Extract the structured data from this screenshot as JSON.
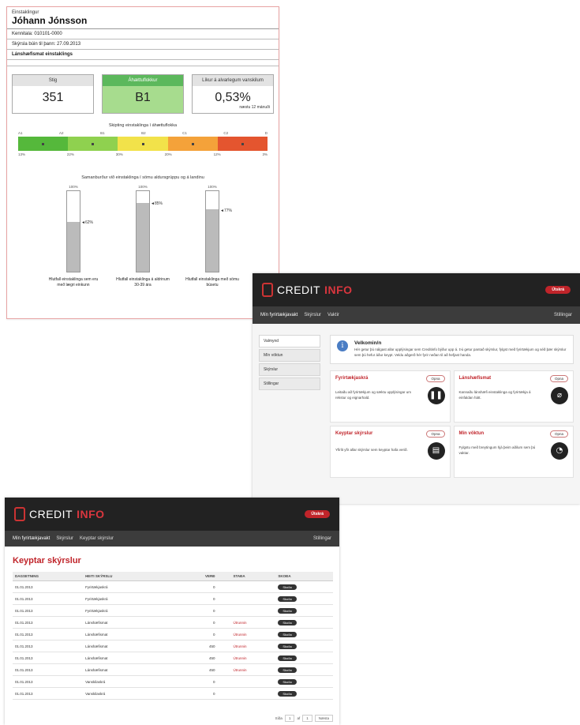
{
  "report": {
    "subject_label": "Einstaklingur",
    "subject_name": "Jóhann Jónsson",
    "line1": "Kennitala: 010101-0000",
    "line2": "Skýrsla búin til þann: 27.09.2013",
    "line3": "Lánshæfismat einstaklings",
    "boxes": [
      {
        "title": "Stig",
        "value": "351",
        "note": ""
      },
      {
        "title": "Áhættuflokkur",
        "value": "B1",
        "note": ""
      },
      {
        "title": "Líkur á alvarlegum vanskilum",
        "value": "0,53%",
        "note": "næstu 12 mánuði"
      }
    ],
    "risk_title": "Skipting einstaklinga í áhættuflokka",
    "risk_ticks": [
      "A1",
      "A2",
      "B1",
      "B2",
      "C1",
      "C2",
      "D"
    ],
    "risk_pcts": [
      "13%",
      "22%",
      "30%",
      "20%",
      "12%",
      "3%"
    ],
    "gauges_title": "Samanburður við einstaklinga í sömu aldursgrúppu og á landinu",
    "gauges": [
      {
        "top": "100%",
        "mark": "62%",
        "level": 0.62,
        "caption": "Hlutfall einstaklinga sem eru með lægri einkunn"
      },
      {
        "top": "100%",
        "mark": "85%",
        "level": 0.85,
        "caption": "Hlutfall einstaklinga á aldrinum 30-39 ára"
      },
      {
        "top": "100%",
        "mark": "77%",
        "level": 0.77,
        "caption": "Hlutfall einstaklinga með sömu búsetu"
      }
    ]
  },
  "dashboard": {
    "logo_left": "CREDIT",
    "logo_right": "INFO",
    "account_button": "Útskrá",
    "nav": [
      "Mín fyrirtækjavakt",
      "Skýrslur",
      "Vaktir"
    ],
    "nav_right": "Stillingar",
    "side_menu": [
      "Valmynd",
      "Mín vöktun",
      "Skýrslur",
      "Stillingar"
    ],
    "welcome_title": "Velkomin/n",
    "welcome_text": "Hér getur þú nálgast allar upplýsingar sem Creditinfo býður upp á. Þú getur pantað skýrslur, fylgst með fyrirtækjum og séð þær skýrslur sem þú hefur áður keypt. Veldu aðgerð hér fyrir neðan til að hefjast handa.",
    "tiles": [
      {
        "title": "Fyrirtækjaskrá",
        "btn": "Opna",
        "text": "Leitaðu að fyrirtækjum og sæktu upplýsingar um rekstur og eignarhald.",
        "icon": "❚❚"
      },
      {
        "title": "Lánshæfismat",
        "btn": "Opna",
        "text": "Kannaðu lánshæfi einstaklinga og fyrirtækja á einfaldan hátt.",
        "icon": "⌀"
      },
      {
        "title": "Keyptar skýrslur",
        "btn": "Opna",
        "text": "Yfirlit yfir allar skýrslur sem keyptar hafa verið.",
        "icon": "▤"
      },
      {
        "title": "Mín vöktun",
        "btn": "Opna",
        "text": "Fylgstu með breytingum hjá þeim aðilum sem þú vaktar.",
        "icon": "◔"
      }
    ]
  },
  "list": {
    "logo_left": "CREDIT",
    "logo_right": "INFO",
    "account_button": "Útskrá",
    "nav": [
      "Mín fyrirtækjavakt",
      "Skýrslur",
      "Keyptar skýrslur"
    ],
    "nav_right": "Stillingar",
    "title": "Keyptar skýrslur",
    "columns": [
      "DAGSETNING",
      "HEITI SKÝRSLU",
      "VERÐ",
      "STAÐA",
      "SKOÐA"
    ],
    "rows": [
      {
        "date": "01.01.2013",
        "name": "Fyrirtækjaskrá",
        "price": "0",
        "status": "",
        "btn": "Skoða"
      },
      {
        "date": "01.01.2013",
        "name": "Fyrirtækjaskrá",
        "price": "0",
        "status": "",
        "btn": "Skoða"
      },
      {
        "date": "01.01.2013",
        "name": "Fyrirtækjaskrá",
        "price": "0",
        "status": "",
        "btn": "Skoða"
      },
      {
        "date": "01.01.2013",
        "name": "Lánshæfismat",
        "price": "0",
        "status": "Útrunnin",
        "btn": "Skoða"
      },
      {
        "date": "01.01.2013",
        "name": "Lánshæfismat",
        "price": "0",
        "status": "Útrunnin",
        "btn": "Skoða"
      },
      {
        "date": "01.01.2013",
        "name": "Lánshæfismat",
        "price": "450",
        "status": "Útrunnin",
        "btn": "Skoða"
      },
      {
        "date": "01.01.2013",
        "name": "Lánshæfismat",
        "price": "450",
        "status": "Útrunnin",
        "btn": "Skoða"
      },
      {
        "date": "01.01.2013",
        "name": "Lánshæfismat",
        "price": "450",
        "status": "Útrunnin",
        "btn": "Skoða"
      },
      {
        "date": "01.01.2013",
        "name": "Vanskilaskrá",
        "price": "0",
        "status": "",
        "btn": "Skoða"
      },
      {
        "date": "01.01.2013",
        "name": "Vanskilaskrá",
        "price": "0",
        "status": "",
        "btn": "Skoða"
      }
    ],
    "pager": [
      "Síða",
      "1",
      "af",
      "1",
      "Næsta"
    ]
  },
  "colors": {
    "brand_red": "#c0242a",
    "risk_segments": [
      "#55b83b",
      "#8fd14f",
      "#f2e24a",
      "#f4a23a",
      "#e4552f"
    ]
  }
}
